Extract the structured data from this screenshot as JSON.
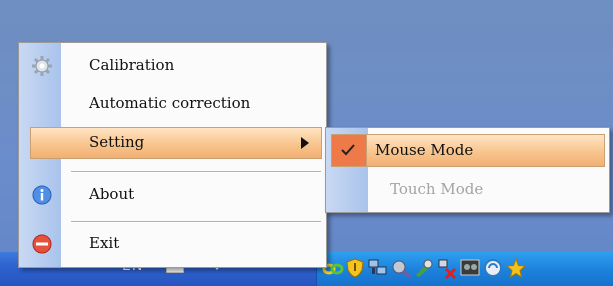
{
  "taskbar": {
    "language": "EN",
    "tray_icons": [
      "link-icon",
      "shield-icon",
      "network-icon",
      "satellite-icon",
      "tool-icon",
      "network-error-icon",
      "display-icon",
      "sync-icon",
      "star-icon"
    ]
  },
  "context_menu": {
    "items": [
      {
        "label": "Calibration",
        "icon": "gear-icon"
      },
      {
        "label": "Automatic correction",
        "icon": ""
      },
      {
        "label": "Setting",
        "icon": "",
        "has_submenu": true
      },
      {
        "label": "About",
        "icon": "info-icon"
      },
      {
        "label": "Exit",
        "icon": "exit-icon"
      }
    ]
  },
  "submenu": {
    "items": [
      {
        "label": "Mouse Mode",
        "checked": true,
        "enabled": true
      },
      {
        "label": "Touch Mode",
        "checked": false,
        "enabled": false
      }
    ]
  },
  "colors": {
    "highlight": "#f8c58e",
    "check_background": "#ee7a4a",
    "menu_strip": "#b8cdee"
  }
}
